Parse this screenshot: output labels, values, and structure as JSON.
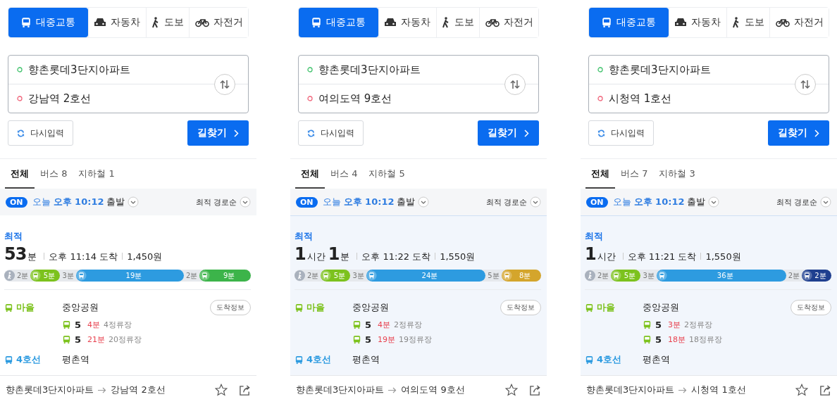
{
  "panels": [
    {
      "mode_tabs": [
        {
          "kind": "transit",
          "label": "대중교통",
          "selected": true
        },
        {
          "kind": "car",
          "label": "자동차",
          "selected": false
        },
        {
          "kind": "walk",
          "label": "도보",
          "selected": false
        },
        {
          "kind": "bike",
          "label": "자전거",
          "selected": false
        }
      ],
      "origin": "향촌롯데3단지아파트",
      "destination": "강남역 2호선",
      "reset_button": "다시입력",
      "search_button": "길찾기",
      "filters": [
        {
          "label": "전체",
          "selected": true
        },
        {
          "label": "버스 8",
          "selected": false
        },
        {
          "label": "지하철 1",
          "selected": false
        }
      ],
      "departure": {
        "on": true,
        "toggle": "ON",
        "day": "오늘",
        "time": "오후 10:12",
        "suffix": "출발"
      },
      "sort": "최적 경로순",
      "route": {
        "selected": false,
        "badge": "최적",
        "duration": [
          {
            "num": "53",
            "unit": "분"
          }
        ],
        "arrival": "오후 11:14 도착",
        "fare": "1,450원",
        "segments": [
          {
            "kind": "walk",
            "label": "2분"
          },
          {
            "kind": "ride",
            "label": "5분",
            "color": "#7cc21d"
          },
          {
            "kind": "gap",
            "label": "3분"
          },
          {
            "kind": "ride",
            "label": "19분",
            "color": "#2d9be0"
          },
          {
            "kind": "gap",
            "label": "2분"
          },
          {
            "kind": "ride",
            "label": "9분",
            "color": "#3cb44a"
          }
        ],
        "legs": [
          {
            "mode": "마을",
            "color": "#7cc21d",
            "station": "중앙공원",
            "button": "도착정보",
            "arrivals": [
              {
                "route": "5",
                "eta": "4분",
                "stops": "4정류장"
              },
              {
                "route": "5",
                "eta": "21분",
                "stops": "20정류장"
              }
            ]
          },
          {
            "mode": "4호선",
            "color": "#2d9be0",
            "station": "평촌역"
          }
        ]
      },
      "footer": {
        "origin": "향촌롯데3단지아파트",
        "destination": "강남역 2호선"
      }
    },
    {
      "mode_tabs": [
        {
          "kind": "transit",
          "label": "대중교통",
          "selected": true
        },
        {
          "kind": "car",
          "label": "자동차",
          "selected": false
        },
        {
          "kind": "walk",
          "label": "도보",
          "selected": false
        },
        {
          "kind": "bike",
          "label": "자전거",
          "selected": false
        }
      ],
      "origin": "향촌롯데3단지아파트",
      "destination": "여의도역 9호선",
      "reset_button": "다시입력",
      "search_button": "길찾기",
      "filters": [
        {
          "label": "전체",
          "selected": true
        },
        {
          "label": "버스 4",
          "selected": false
        },
        {
          "label": "지하철 5",
          "selected": false
        }
      ],
      "departure": {
        "on": true,
        "toggle": "ON",
        "day": "오늘",
        "time": "오후 10:12",
        "suffix": "출발"
      },
      "sort": "최적 경로순",
      "route": {
        "selected": true,
        "badge": "최적",
        "duration": [
          {
            "num": "1",
            "unit": "시간"
          },
          {
            "num": "1",
            "unit": "분"
          }
        ],
        "arrival": "오후 11:22 도착",
        "fare": "1,550원",
        "segments": [
          {
            "kind": "walk",
            "label": "2분"
          },
          {
            "kind": "ride",
            "label": "5분",
            "color": "#7cc21d"
          },
          {
            "kind": "gap",
            "label": "3분"
          },
          {
            "kind": "ride",
            "label": "24분",
            "color": "#2d9be0"
          },
          {
            "kind": "gap",
            "label": "5분"
          },
          {
            "kind": "ride",
            "label": "8분",
            "color": "#d4a52c"
          }
        ],
        "legs": [
          {
            "mode": "마을",
            "color": "#7cc21d",
            "station": "중앙공원",
            "button": "도착정보",
            "arrivals": [
              {
                "route": "5",
                "eta": "4분",
                "stops": "2정류장"
              },
              {
                "route": "5",
                "eta": "19분",
                "stops": "19정류장"
              }
            ]
          },
          {
            "mode": "4호선",
            "color": "#2d9be0",
            "station": "평촌역"
          }
        ]
      },
      "footer": {
        "origin": "향촌롯데3단지아파트",
        "destination": "여의도역 9호선"
      }
    },
    {
      "mode_tabs": [
        {
          "kind": "transit",
          "label": "대중교통",
          "selected": true
        },
        {
          "kind": "car",
          "label": "자동차",
          "selected": false
        },
        {
          "kind": "walk",
          "label": "도보",
          "selected": false
        },
        {
          "kind": "bike",
          "label": "자전거",
          "selected": false
        }
      ],
      "origin": "향촌롯데3단지아파트",
      "destination": "시청역 1호선",
      "reset_button": "다시입력",
      "search_button": "길찾기",
      "filters": [
        {
          "label": "전체",
          "selected": true
        },
        {
          "label": "버스 7",
          "selected": false
        },
        {
          "label": "지하철 3",
          "selected": false
        }
      ],
      "departure": {
        "on": true,
        "toggle": "ON",
        "day": "오늘",
        "time": "오후 10:12",
        "suffix": "출발"
      },
      "sort": "최적 경로순",
      "route": {
        "selected": true,
        "badge": "최적",
        "duration": [
          {
            "num": "1",
            "unit": "시간"
          }
        ],
        "arrival": "오후 11:21 도착",
        "fare": "1,550원",
        "segments": [
          {
            "kind": "walk",
            "label": "2분"
          },
          {
            "kind": "ride",
            "label": "5분",
            "color": "#7cc21d"
          },
          {
            "kind": "gap",
            "label": "3분"
          },
          {
            "kind": "ride",
            "label": "36분",
            "color": "#2d9be0"
          },
          {
            "kind": "gap",
            "label": "2분"
          },
          {
            "kind": "ride",
            "label": "2분",
            "color": "#1f3f8f"
          }
        ],
        "legs": [
          {
            "mode": "마을",
            "color": "#7cc21d",
            "station": "중앙공원",
            "button": "도착정보",
            "arrivals": [
              {
                "route": "5",
                "eta": "3분",
                "stops": "2정류장"
              },
              {
                "route": "5",
                "eta": "18분",
                "stops": "18정류장"
              }
            ]
          },
          {
            "mode": "4호선",
            "color": "#2d9be0",
            "station": "평촌역"
          }
        ]
      },
      "footer": {
        "origin": "향촌롯데3단지아파트",
        "destination": "시청역 1호선"
      }
    }
  ]
}
